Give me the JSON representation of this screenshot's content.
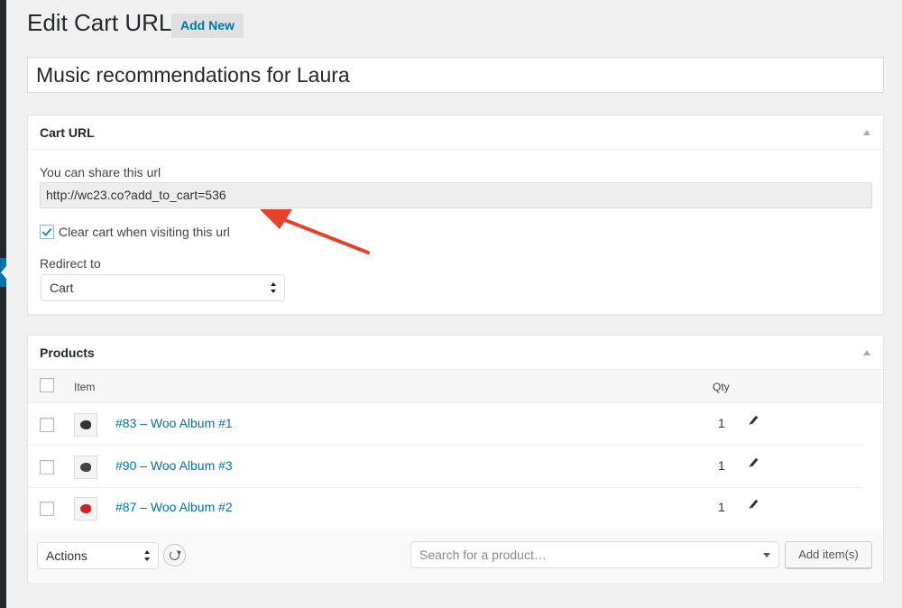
{
  "header": {
    "page_title": "Edit Cart URL",
    "add_new_label": "Add New"
  },
  "post_title": "Music recommendations for Laura",
  "cart_url_box": {
    "title": "Cart URL",
    "share_label": "You can share this url",
    "share_url": "http://wc23.co?add_to_cart=536",
    "clear_cart_label": "Clear cart when visiting this url",
    "clear_cart_checked": true,
    "redirect_label": "Redirect to",
    "redirect_value": "Cart"
  },
  "products_box": {
    "title": "Products",
    "columns": {
      "item": "Item",
      "qty": "Qty"
    },
    "rows": [
      {
        "name": "#83 – Woo Album #1",
        "qty": "1",
        "thumb_color": "#333333"
      },
      {
        "name": "#90 – Woo Album #3",
        "qty": "1",
        "thumb_color": "#444444"
      },
      {
        "name": "#87 – Woo Album #2",
        "qty": "1",
        "thumb_color": "#cc2222"
      }
    ],
    "actions_value": "Actions",
    "search_placeholder": "Search for a product…",
    "add_items_label": "Add item(s)"
  },
  "annotation": {
    "arrow_color": "#e8412a"
  },
  "colors": {
    "link": "#0073aa",
    "admin_bar": "#23282d"
  }
}
